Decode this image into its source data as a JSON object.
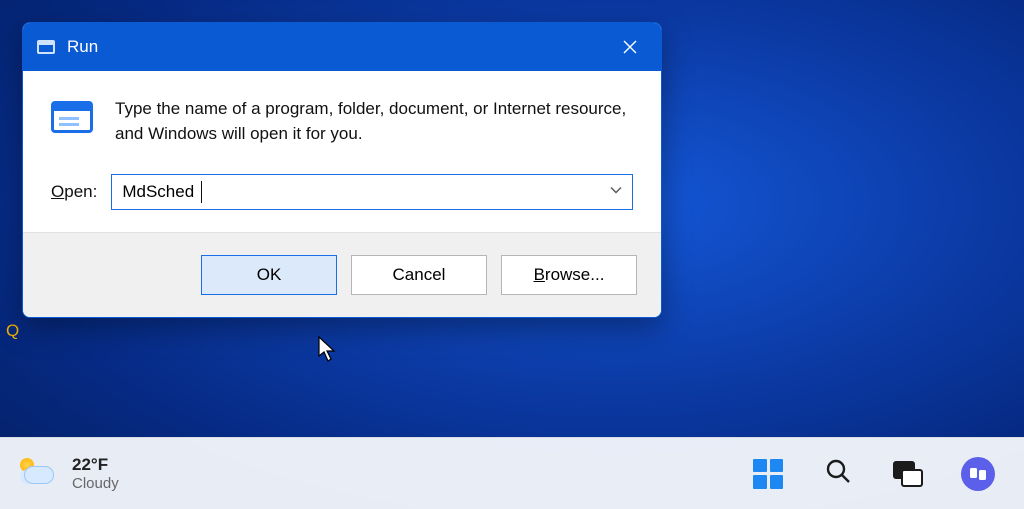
{
  "runDialog": {
    "title": "Run",
    "description": "Type the name of a program, folder, document, or Internet resource, and Windows will open it for you.",
    "openLabel": {
      "accel": "O",
      "rest": "pen:"
    },
    "inputValue": "MdSched",
    "buttons": {
      "ok": "OK",
      "cancel": "Cancel",
      "browse": {
        "accel": "B",
        "rest": "rowse..."
      }
    }
  },
  "edgeQ": "Q",
  "taskbar": {
    "weather": {
      "temp": "22°F",
      "condition": "Cloudy"
    }
  }
}
